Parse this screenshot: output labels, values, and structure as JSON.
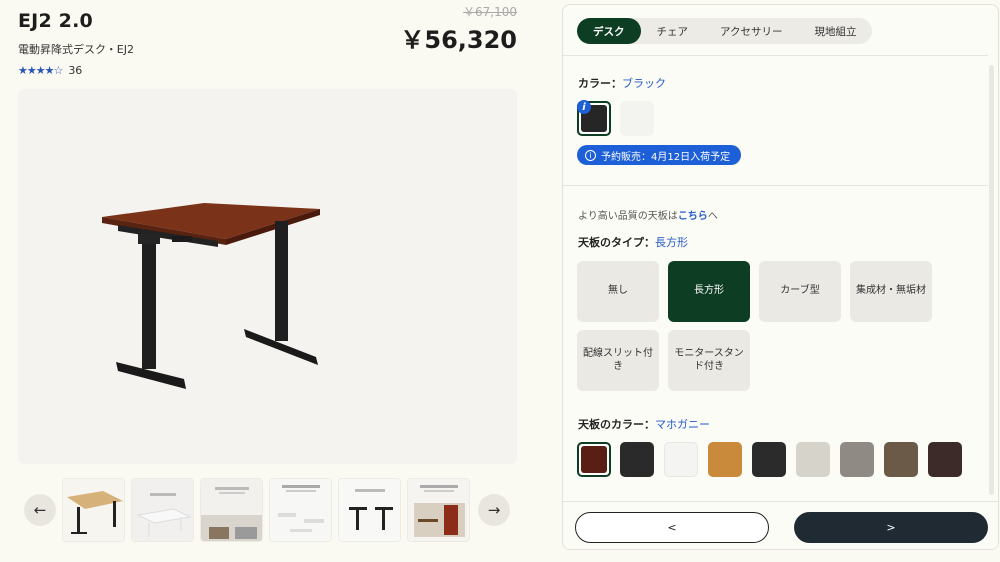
{
  "product": {
    "name": "EJ2 2.0",
    "subtitle": "電動昇降式デスク・EJ2",
    "stars": "★★★★☆",
    "review_count": "36",
    "old_price": "￥67,100",
    "price": "￥56,320"
  },
  "gallery": {
    "prev_icon": "←",
    "next_icon": "→"
  },
  "tabs": [
    {
      "label": "デスク",
      "active": true
    },
    {
      "label": "チェア",
      "active": false
    },
    {
      "label": "アクセサリー",
      "active": false
    },
    {
      "label": "現地組立",
      "active": false
    }
  ],
  "color": {
    "label": "カラー：",
    "value": "ブラック",
    "info_mark": "i",
    "swatches": [
      "#262626",
      "#f3f3f0"
    ]
  },
  "notice": {
    "icon": "i",
    "text": "予約販売：4月12日入荷予定"
  },
  "higher_quality": {
    "prefix": "より高い品質の天板は",
    "link": "こちら",
    "suffix": "へ"
  },
  "top_type": {
    "label": "天板のタイプ：",
    "value": "長方形",
    "options": [
      {
        "label": "無し",
        "active": false
      },
      {
        "label": "長方形",
        "active": true
      },
      {
        "label": "カーブ型",
        "active": false
      },
      {
        "label": "集成材・無垢材",
        "active": false
      },
      {
        "label": "配線スリット付き",
        "active": false
      },
      {
        "label": "モニタースタンド付き",
        "active": false
      }
    ]
  },
  "top_color": {
    "label": "天板のカラー：",
    "value": "マホガニー",
    "swatches": [
      "#5a1f14",
      "#2a2a2a",
      "#f4f4f2",
      "#c98a3c",
      "#2b2b2b",
      "#d6d3cb",
      "#8f8a84",
      "#6b5a48",
      "#3d2b29"
    ]
  },
  "footer": {
    "prev_label": "<",
    "next_label": ">"
  }
}
